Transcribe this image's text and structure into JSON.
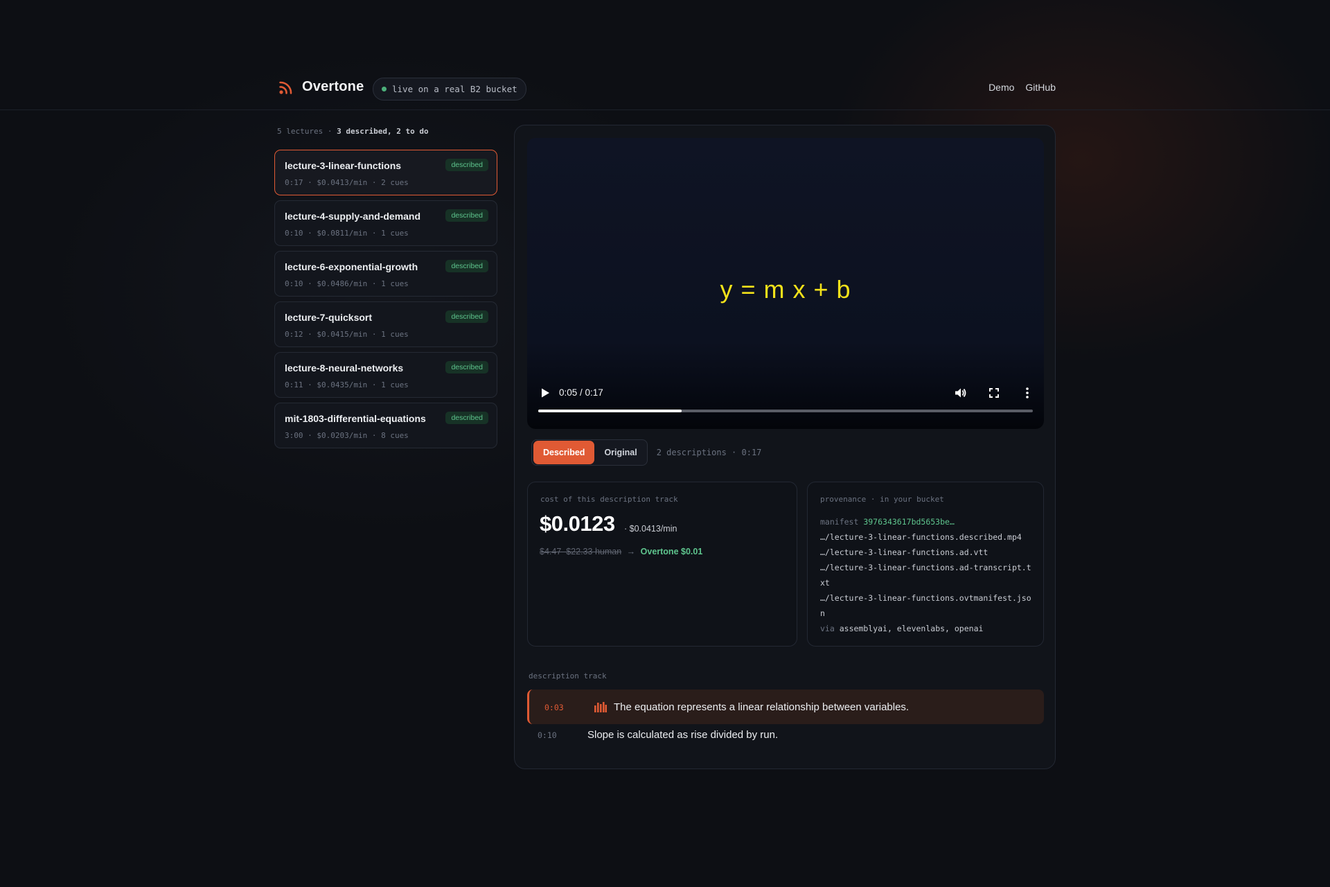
{
  "header": {
    "brand": "Overtone",
    "live_status": "live on a real B2 bucket",
    "nav": [
      "Demo",
      "GitHub"
    ]
  },
  "sidebar": {
    "summary_count": "5 lectures",
    "summary_sep": "·",
    "summary_status": "3 described, 2 to do",
    "lectures": [
      {
        "title": "lecture-3-linear-functions",
        "meta": "0:17 · $0.0413/min · 2 cues",
        "badge": "described",
        "selected": true
      },
      {
        "title": "lecture-4-supply-and-demand",
        "meta": "0:10 · $0.0811/min · 1 cues",
        "badge": "described",
        "selected": false
      },
      {
        "title": "lecture-6-exponential-growth",
        "meta": "0:10 · $0.0486/min · 1 cues",
        "badge": "described",
        "selected": false
      },
      {
        "title": "lecture-7-quicksort",
        "meta": "0:12 · $0.0415/min · 1 cues",
        "badge": "described",
        "selected": false
      },
      {
        "title": "lecture-8-neural-networks",
        "meta": "0:11 · $0.0435/min · 1 cues",
        "badge": "described",
        "selected": false
      },
      {
        "title": "mit-1803-differential-equations",
        "meta": "3:00 · $0.0203/min · 8 cues",
        "badge": "described",
        "selected": false
      }
    ]
  },
  "player": {
    "frame_text": "y = m x + b",
    "time": "0:05 / 0:17",
    "progress_fraction": 0.29,
    "icons": [
      "play-icon",
      "volume-icon",
      "fullscreen-icon",
      "more-vert-icon"
    ]
  },
  "tabs": {
    "described": "Described",
    "original": "Original",
    "active": "Described",
    "info": "2 descriptions · 0:17"
  },
  "cost_card": {
    "label": "cost of this description track",
    "amount": "$0.0123",
    "rate": "· $0.0413/min",
    "human_cost": "$4.47–$22.33 human",
    "arrow": "→",
    "overtone_cost": "Overtone $0.01"
  },
  "provenance_card": {
    "label": "provenance · in your bucket",
    "manifest_label": "manifest",
    "manifest_hash": "3976343617bd5653be…",
    "files": [
      "…/lecture-3-linear-functions.described.mp4",
      "…/lecture-3-linear-functions.ad.vtt",
      "…/lecture-3-linear-functions.ad-transcript.txt",
      "…/lecture-3-linear-functions.ovtmanifest.json"
    ],
    "via_label": "via",
    "via_value": "assemblyai, elevenlabs, openai"
  },
  "description_track": {
    "label": "description track",
    "cues": [
      {
        "time": "0:03",
        "text": "The equation represents a linear relationship between variables.",
        "active": true
      },
      {
        "time": "0:10",
        "text": "Slope is calculated as rise divided by run.",
        "active": false
      }
    ]
  },
  "colors": {
    "accent": "#e05a34",
    "success": "#5ec48d",
    "background": "#0d0f14",
    "equation": "#f2e11a"
  }
}
